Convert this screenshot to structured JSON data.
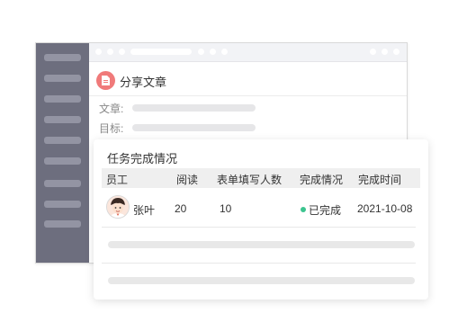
{
  "share_header": {
    "title": "分享文章",
    "icon": "document-icon",
    "icon_color": "#f07a7a"
  },
  "share_fields": {
    "article_label": "文章:",
    "target_label": "目标:"
  },
  "task_card": {
    "title": "任务完成情况",
    "columns": [
      "员工",
      "阅读",
      "表单填写人数",
      "完成情况",
      "完成时间"
    ],
    "rows": [
      {
        "name": "张叶",
        "reads": "20",
        "form_fills": "10",
        "status": "已完成",
        "status_color": "#3cc48f",
        "completed_at": "2021-10-08"
      }
    ]
  },
  "colors": {
    "sidebar": "#6d6e7e",
    "header_bg": "#efefef"
  }
}
